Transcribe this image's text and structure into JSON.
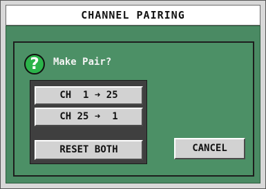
{
  "window": {
    "title": "CHANNEL PAIRING"
  },
  "dialog": {
    "icon": "question-icon",
    "icon_glyph": "?",
    "prompt": "Make Pair?",
    "buttons": {
      "ch1_to_25": "CH  1 ➜ 25",
      "ch25_to_1": "CH 25 ➜  1",
      "reset_both": "RESET BOTH",
      "cancel": "CANCEL"
    }
  },
  "colors": {
    "background_green": "#4a8a63",
    "button_face": "#d2d2d2",
    "icon_green": "#2bb34a"
  }
}
